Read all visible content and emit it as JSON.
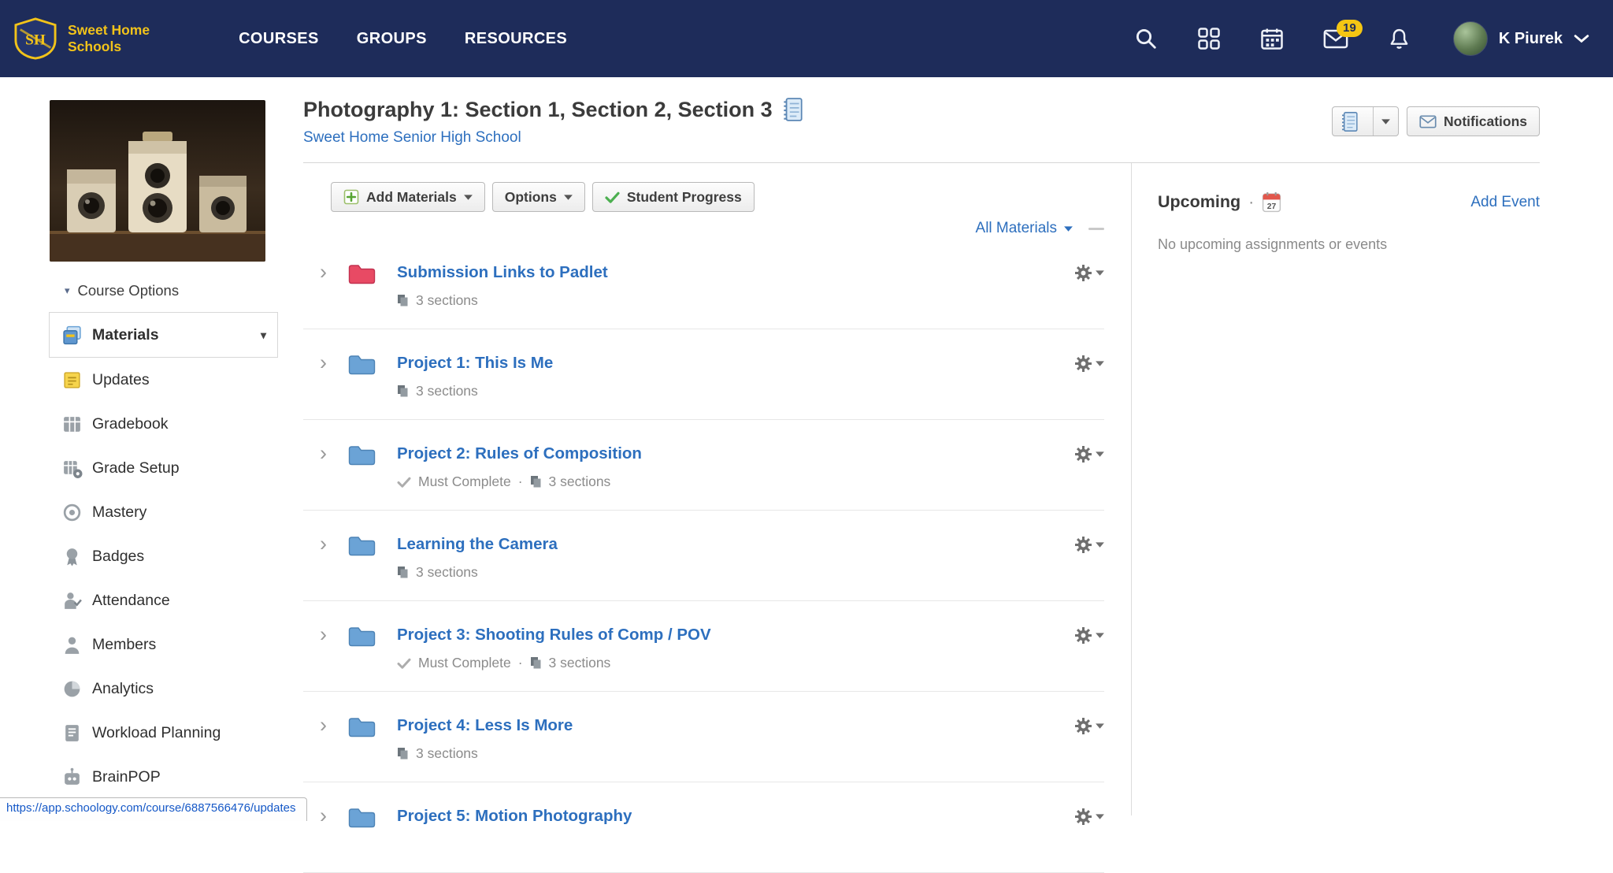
{
  "colors": {
    "header_bg": "#1e2c5a",
    "brand_gold": "#f2c31a",
    "link_blue": "#2d6fbe",
    "folder_blue": "#6ba3d6",
    "folder_red": "#e84a64",
    "badge_yellow": "#f4c613",
    "success_green": "#4caf50"
  },
  "icons": {
    "caret_down": "▾",
    "chevron_right": "›",
    "dot": "·"
  },
  "header": {
    "brand_line1": "Sweet Home",
    "brand_line2": "Schools",
    "nav": [
      {
        "label": "COURSES"
      },
      {
        "label": "GROUPS"
      },
      {
        "label": "RESOURCES"
      }
    ],
    "messages_badge": "19",
    "user_name": "K Piurek"
  },
  "sidebar": {
    "course_options": "Course Options",
    "items": [
      {
        "label": "Materials"
      },
      {
        "label": "Updates"
      },
      {
        "label": "Gradebook"
      },
      {
        "label": "Grade Setup"
      },
      {
        "label": "Mastery"
      },
      {
        "label": "Badges"
      },
      {
        "label": "Attendance"
      },
      {
        "label": "Members"
      },
      {
        "label": "Analytics"
      },
      {
        "label": "Workload Planning"
      },
      {
        "label": "BrainPOP"
      }
    ]
  },
  "main": {
    "title": "Photography 1: Section 1, Section 2, Section 3",
    "school": "Sweet Home Senior High School",
    "toolbar": {
      "add_materials": "Add Materials",
      "options": "Options",
      "student_progress": "Student Progress"
    },
    "filter_label": "All Materials",
    "must_complete": "Must Complete",
    "folders": [
      {
        "title": "Submission Links to Padlet",
        "sections": "3 sections",
        "color": "#e84a64",
        "must_complete": false
      },
      {
        "title": "Project 1: This Is Me",
        "sections": "3 sections",
        "color": "#6ba3d6",
        "must_complete": false
      },
      {
        "title": "Project 2: Rules of Composition",
        "sections": "3 sections",
        "color": "#6ba3d6",
        "must_complete": true
      },
      {
        "title": "Learning the Camera",
        "sections": "3 sections",
        "color": "#6ba3d6",
        "must_complete": false
      },
      {
        "title": "Project 3: Shooting Rules of Comp / POV",
        "sections": "3 sections",
        "color": "#6ba3d6",
        "must_complete": true
      },
      {
        "title": "Project 4: Less Is More",
        "sections": "3 sections",
        "color": "#6ba3d6",
        "must_complete": false
      },
      {
        "title": "Project 5: Motion Photography",
        "sections": "",
        "color": "#6ba3d6",
        "must_complete": false
      }
    ]
  },
  "right_panel": {
    "notifications": "Notifications",
    "upcoming": "Upcoming",
    "add_event": "Add Event",
    "empty": "No upcoming assignments or events",
    "calendar_day": "27"
  },
  "status_bar": {
    "url": "https://app.schoology.com/course/6887566476/updates"
  }
}
